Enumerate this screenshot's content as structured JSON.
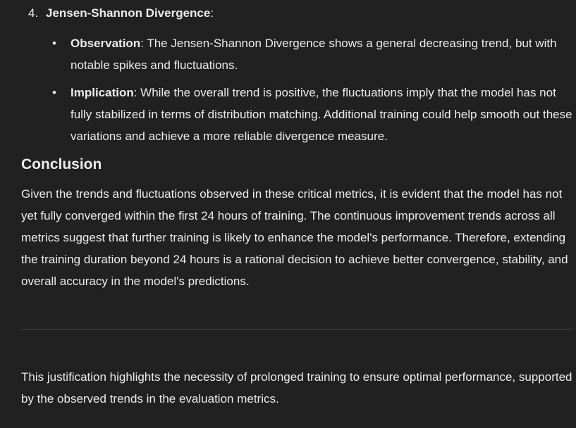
{
  "item4": {
    "number": "4.",
    "title": "Jensen-Shannon Divergence",
    "colon": ":",
    "bullets": [
      {
        "term": "Observation",
        "text": ": The Jensen-Shannon Divergence shows a general decreasing trend, but with notable spikes and fluctuations."
      },
      {
        "term": "Implication",
        "text": ": While the overall trend is positive, the fluctuations imply that the model has not fully stabilized in terms of distribution matching. Additional training could help smooth out these variations and achieve a more reliable divergence measure."
      }
    ]
  },
  "conclusion": {
    "heading": "Conclusion",
    "body": "Given the trends and fluctuations observed in these critical metrics, it is evident that the model has not yet fully converged within the first 24 hours of training. The continuous improvement trends across all metrics suggest that further training is likely to enhance the model's performance. Therefore, extending the training duration beyond 24 hours is a rational decision to achieve better convergence, stability, and overall accuracy in the model's predictions."
  },
  "footer_note": "This justification highlights the necessity of prolonged training to ensure optimal performance, supported by the observed trends in the evaluation metrics.",
  "colors": {
    "background": "#212121",
    "text": "#ececec",
    "divider": "#4a4a4a"
  }
}
